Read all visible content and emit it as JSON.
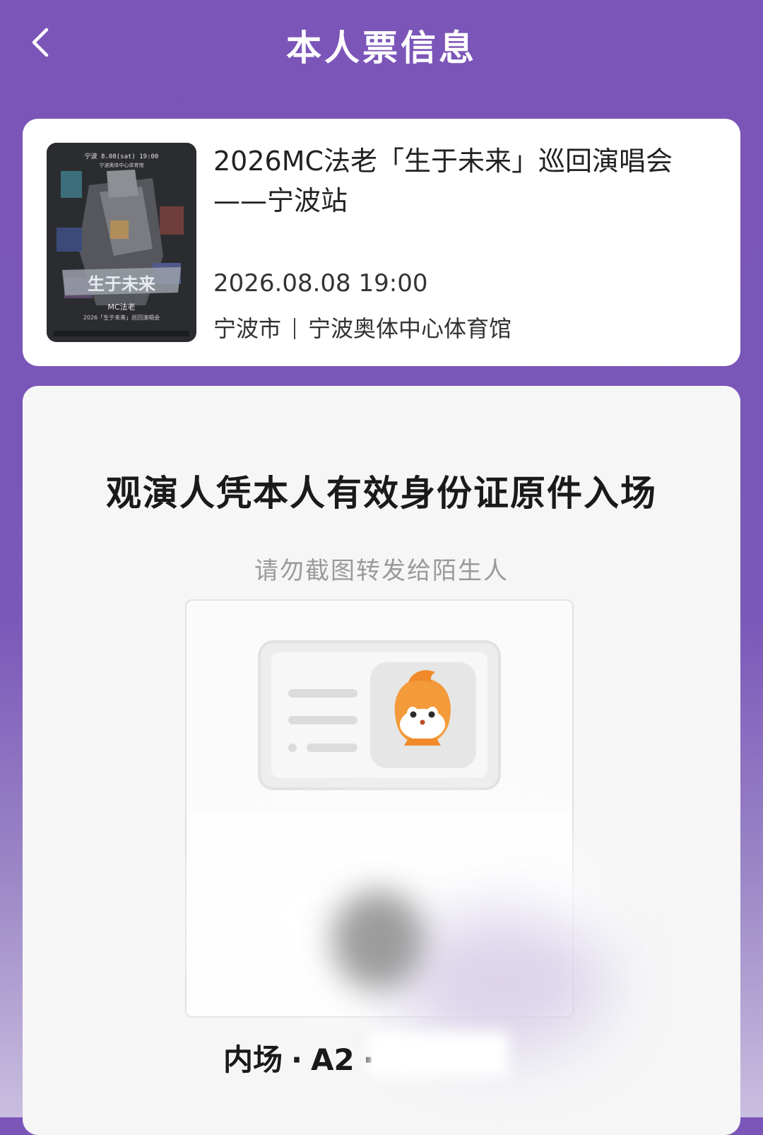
{
  "header": {
    "title": "本人票信息",
    "back_icon": "chevron-left-icon"
  },
  "event": {
    "title": "2026MC法老「生于未来」巡回演唱会——宁波站",
    "datetime": "2026.08.08 19:00",
    "city": "宁波市",
    "venue": "宁波奥体中心体育馆",
    "poster": {
      "top_line": "宁波 8.08(sat) 19:00",
      "sub_line": "宁波奥体中心体育馆",
      "logo_text": "生于未来",
      "artist": "MC法老",
      "tour": "2026「生于未来」巡回演唱会"
    }
  },
  "ticket": {
    "entry_notice": "观演人凭本人有效身份证原件入场",
    "warning": "请勿截图转发给陌生人",
    "illustration_icon": "id-card-icon",
    "seat_area": "内场",
    "seat_separator": "·",
    "seat_row": "A2",
    "seat_separator_2": "·"
  }
}
